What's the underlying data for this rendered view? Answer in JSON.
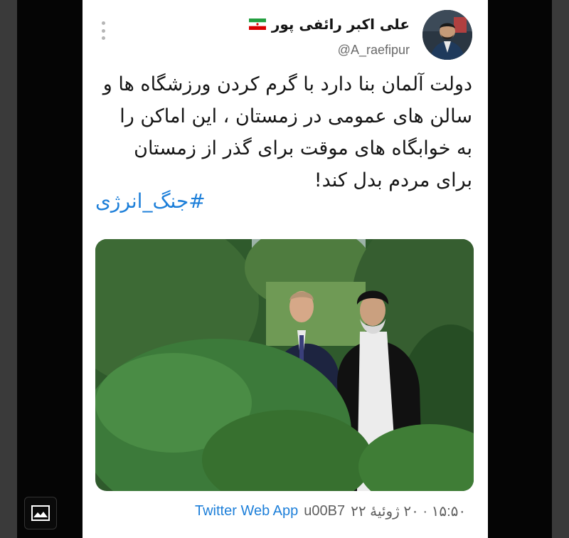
{
  "tweet": {
    "author_name": "علی اکبر رائفی پور",
    "handle": "@A_raefipur",
    "text": "دولت آلمان بنا دارد با گرم کردن ورزشگاه ها و سالن های عمومی در زمستان ، این اماکن را به خوابگاه های موقت برای گذر از زمستان برای مردم بدل کند!",
    "hashtag": "#جنگ_انرژی",
    "timestamp": "۱۵:۵۰ · ۲۰ ژوئیهٔ ۲۲",
    "separator": "u00B7",
    "source": "Twitter Web App"
  },
  "icons": {
    "flag": "iran-flag-icon",
    "more": "more-options-icon",
    "gallery": "image-gallery-icon"
  },
  "colors": {
    "link": "#1d7fd9",
    "text": "#161616",
    "secondary": "#6a6a6a"
  }
}
